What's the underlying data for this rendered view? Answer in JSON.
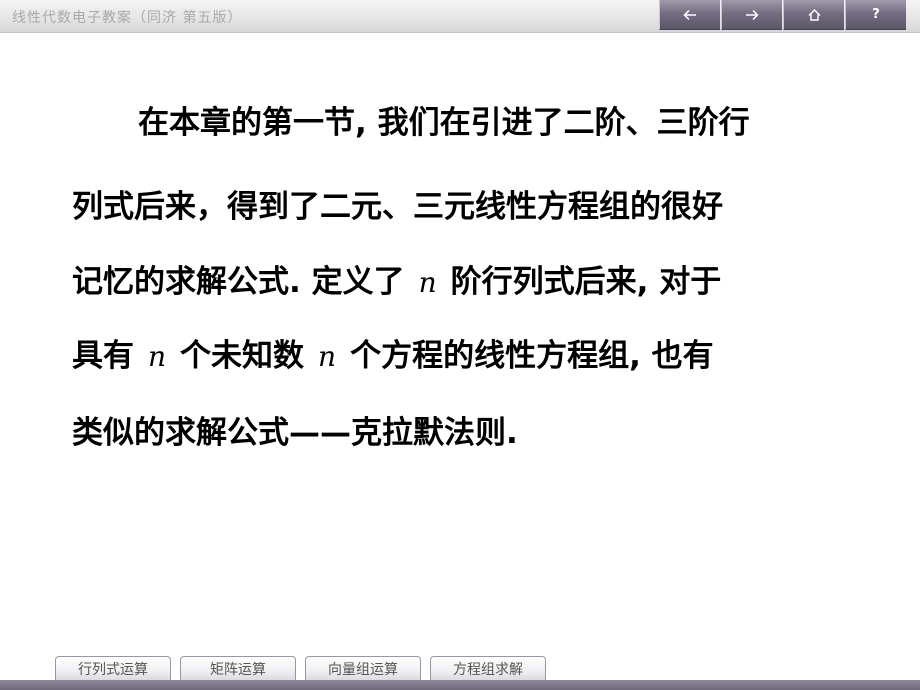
{
  "header": {
    "title": "线性代数电子教案（同济  第五版）",
    "nav_buttons": [
      {
        "icon": "arrow-left-icon"
      },
      {
        "icon": "arrow-right-icon"
      },
      {
        "icon": "home-icon"
      },
      {
        "icon": "help-icon",
        "label": "?"
      }
    ]
  },
  "content": {
    "line1": "在本章的第一节, 我们在引进了二阶、三阶行",
    "line2": "列式后来，得到了二元、三元线性方程组的很好",
    "line3_a": "记忆的求解公式.  定义了",
    "line3_math": "n",
    "line3_b": "阶行列式后来,  对于",
    "line4_a": "具有",
    "line4_math1": "n",
    "line4_b": "个未知数",
    "line4_math2": "n",
    "line4_c": "个方程的线性方程组,  也有",
    "line5": "类似的求解公式——克拉默法则."
  },
  "tabs": [
    {
      "label": "行列式运算"
    },
    {
      "label": "矩阵运算"
    },
    {
      "label": "向量组运算"
    },
    {
      "label": "方程组求解"
    }
  ]
}
